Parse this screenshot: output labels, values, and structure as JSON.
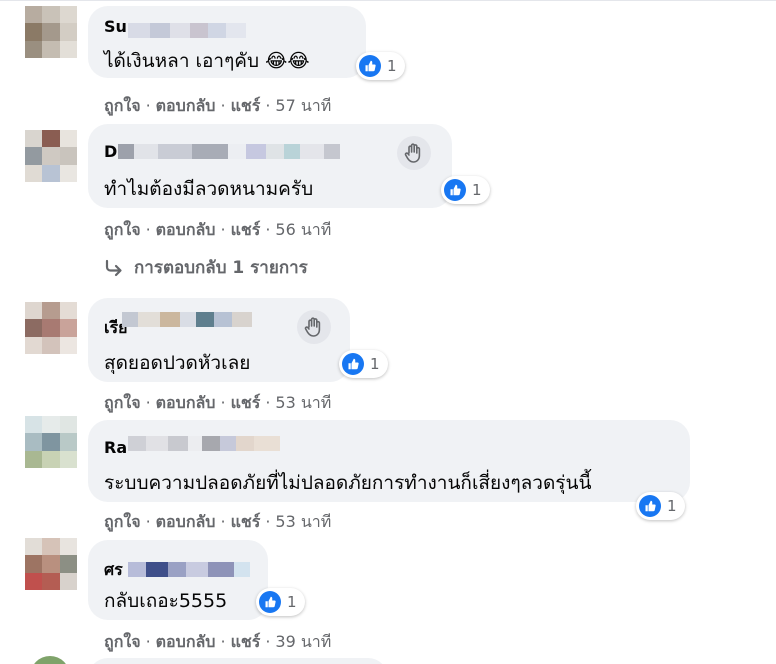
{
  "colors": {
    "like_blue": "#1877f2",
    "bubble": "#f0f2f5",
    "meta": "#65676b"
  },
  "action_labels": {
    "like": "ถูกใจ",
    "reply": "ตอบกลับ",
    "share": "แชร์",
    "dot": "·"
  },
  "comments": [
    {
      "name_visible": "Su",
      "text": "ได้เงินหลา เอาๆคับ 😂😂",
      "reactions": "1",
      "time": "57 นาที"
    },
    {
      "name_visible": "D",
      "text": "ทำไมต้องมีลวดหนามครับ",
      "reactions": "1",
      "time": "56 นาที",
      "wave_icon": "wave-icon"
    },
    {
      "name_visible": "เรีย",
      "text": "สุดยอดปวดหัวเลย",
      "reactions": "1",
      "time": "53 นาที",
      "wave_icon": "wave-icon"
    },
    {
      "name_visible": "Ra",
      "text": "ระบบความปลอดภัยที่ไม่ปลอดภัยการทำงานก็เสี่ยงๆลวดรุ่นนี้",
      "reactions": "1",
      "time": "53 นาที"
    },
    {
      "name_visible": "ศร",
      "text": "กลับเถอะ5555",
      "reactions": "1",
      "time": "39 นาที"
    }
  ],
  "replies_link": "การตอบกลับ 1 รายการ"
}
